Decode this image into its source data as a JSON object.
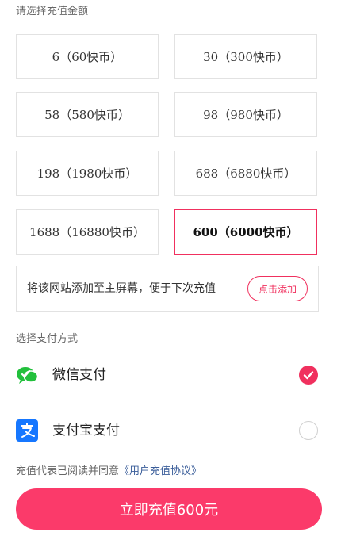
{
  "recharge": {
    "section_label": "请选择充值金额",
    "amounts": [
      {
        "label": "6（60快币）",
        "selected": false
      },
      {
        "label": "30（300快币）",
        "selected": false
      },
      {
        "label": "58（580快币）",
        "selected": false
      },
      {
        "label": "98（980快币）",
        "selected": false
      },
      {
        "label": "198（1980快币）",
        "selected": false
      },
      {
        "label": "688（6880快币）",
        "selected": false
      },
      {
        "label": "1688（16880快币）",
        "selected": false
      },
      {
        "label": "600（6000快币）",
        "selected": true
      }
    ]
  },
  "homescreen": {
    "text": "将该网站添加至主屏幕，便于下次充值",
    "button_label": "点击添加"
  },
  "payment": {
    "section_label": "选择支付方式",
    "methods": [
      {
        "name": "微信支付",
        "icon": "wechat-pay-icon",
        "selected": true
      },
      {
        "name": "支付宝支付",
        "icon": "alipay-icon",
        "selected": false
      }
    ]
  },
  "agreement": {
    "prefix": "充值代表已阅读并同意",
    "link_label": "《用户充值协议》"
  },
  "submit": {
    "label": "立即充值600元"
  },
  "colors": {
    "accent": "#f0305e",
    "button": "#fb3a6a",
    "wechat": "#22c03c",
    "alipay": "#1677ff",
    "link": "#3b5e9a"
  }
}
